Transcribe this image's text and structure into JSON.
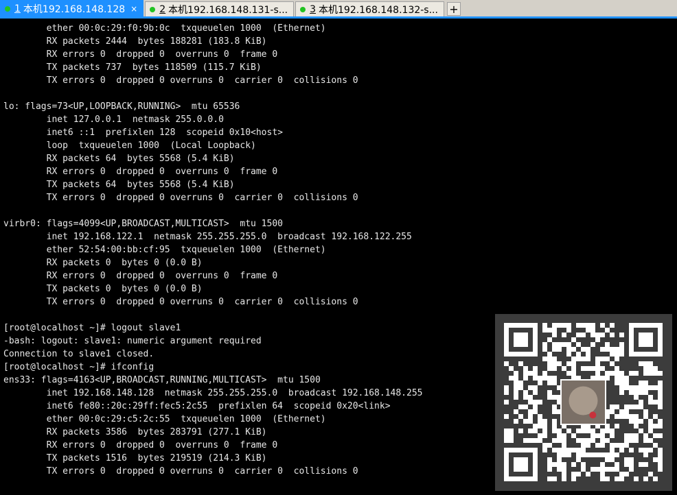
{
  "tabs": [
    {
      "num": "1",
      "label": "本机192.168.148.128",
      "active": true,
      "close": "×"
    },
    {
      "num": "2",
      "label": "本机192.168.148.131-s...",
      "active": false
    },
    {
      "num": "3",
      "label": "本机192.168.148.132-s...",
      "active": false
    }
  ],
  "tab_add_label": "+",
  "terminal": {
    "lines": [
      "        ether 00:0c:29:f0:9b:0c  txqueuelen 1000  (Ethernet)",
      "        RX packets 2444  bytes 188281 (183.8 KiB)",
      "        RX errors 0  dropped 0  overruns 0  frame 0",
      "        TX packets 737  bytes 118509 (115.7 KiB)",
      "        TX errors 0  dropped 0 overruns 0  carrier 0  collisions 0",
      "",
      "lo: flags=73<UP,LOOPBACK,RUNNING>  mtu 65536",
      "        inet 127.0.0.1  netmask 255.0.0.0",
      "        inet6 ::1  prefixlen 128  scopeid 0x10<host>",
      "        loop  txqueuelen 1000  (Local Loopback)",
      "        RX packets 64  bytes 5568 (5.4 KiB)",
      "        RX errors 0  dropped 0  overruns 0  frame 0",
      "        TX packets 64  bytes 5568 (5.4 KiB)",
      "        TX errors 0  dropped 0 overruns 0  carrier 0  collisions 0",
      "",
      "virbr0: flags=4099<UP,BROADCAST,MULTICAST>  mtu 1500",
      "        inet 192.168.122.1  netmask 255.255.255.0  broadcast 192.168.122.255",
      "        ether 52:54:00:bb:cf:95  txqueuelen 1000  (Ethernet)",
      "        RX packets 0  bytes 0 (0.0 B)",
      "        RX errors 0  dropped 0  overruns 0  frame 0",
      "        TX packets 0  bytes 0 (0.0 B)",
      "        TX errors 0  dropped 0 overruns 0  carrier 0  collisions 0",
      "",
      "[root@localhost ~]# logout slave1",
      "-bash: logout: slave1: numeric argument required",
      "Connection to slave1 closed.",
      "[root@localhost ~]# ifconfig",
      "ens33: flags=4163<UP,BROADCAST,RUNNING,MULTICAST>  mtu 1500",
      "        inet 192.168.148.128  netmask 255.255.255.0  broadcast 192.168.148.255",
      "        inet6 fe80::20c:29ff:fec5:2c55  prefixlen 64  scopeid 0x20<link>",
      "        ether 00:0c:29:c5:2c:55  txqueuelen 1000  (Ethernet)",
      "        RX packets 3586  bytes 283791 (277.1 KiB)",
      "        RX errors 0  dropped 0  overruns 0  frame 0",
      "        TX packets 1516  bytes 219519 (214.3 KiB)",
      "        TX errors 0  dropped 0 overruns 0  carrier 0  collisions 0"
    ]
  },
  "colors": {
    "terminal_bg": "#000000",
    "terminal_fg": "#e8e8e8",
    "tab_active_bg": "#1e90ff",
    "tab_status_dot": "#22c322",
    "qr_bg": "#3c3c3c"
  },
  "overlay": {
    "icon": "qr-code-icon"
  }
}
